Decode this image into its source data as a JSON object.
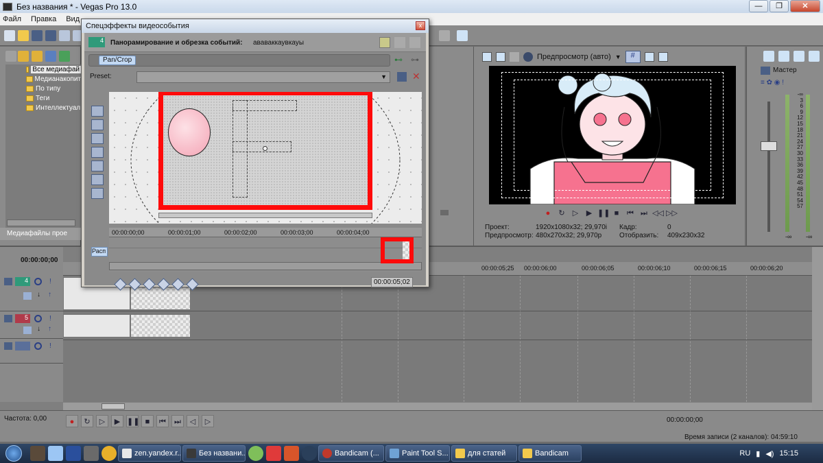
{
  "window": {
    "title": "Без названия * - Vegas Pro 13.0",
    "buttons": [
      "—",
      "❐",
      "✕"
    ]
  },
  "menubar": [
    "Файл",
    "Правка",
    "Вид"
  ],
  "explorer": {
    "tree": [
      {
        "label": "Все медиафай",
        "selected": true
      },
      {
        "label": "Медианакопит",
        "selected": false
      },
      {
        "label": "По типу",
        "selected": false
      },
      {
        "label": "Теги",
        "selected": false
      },
      {
        "label": "Интеллектуал",
        "selected": false
      }
    ],
    "tab_label": "Медиафайлы прое"
  },
  "dialog": {
    "title": "Спецэффекты видеособытия",
    "close": "x",
    "track_badge": "4",
    "fx_label": "Панорамирование и обрезка событий:",
    "fx_name": "ававаккаувкауы",
    "chain_button": "Pan/Crop",
    "preset_label": "Preset:",
    "keyframe_ruler": [
      "00:00:00;00",
      "00:00:01;00",
      "00:00:02;00",
      "00:00:03;00",
      "00:00:04;00"
    ],
    "position_label": "Расп",
    "time_readout": "00:00:05;02"
  },
  "preview": {
    "mode_label": "Предпросмотр (авто)",
    "info": [
      {
        "label": "Проект:",
        "value": "1920x1080x32; 29,970i",
        "label2": "Кадр:",
        "value2": "0"
      },
      {
        "label": "Предпросмотр:",
        "value": "480x270x32; 29,970p",
        "label2": "Отобразить:",
        "value2": "409x230x32"
      }
    ]
  },
  "mixer": {
    "title": "Мастер",
    "scale": [
      "-∞",
      "3",
      "6",
      "9",
      "12",
      "15",
      "18",
      "21",
      "24",
      "27",
      "30",
      "33",
      "36",
      "39",
      "42",
      "45",
      "48",
      "51",
      "54",
      "57"
    ],
    "bottom_left": "-∞",
    "bottom_right": "-∞"
  },
  "timeline": {
    "timecode": "00:00:00;00",
    "ruler": [
      "00:00:05;25",
      "00:00:06;00",
      "00:00:06;05",
      "00:00:06;10",
      "00:00:06;15",
      "00:00:06;20"
    ],
    "tracks": [
      {
        "num": "4",
        "color": "#2f9a7a"
      },
      {
        "num": "5",
        "color": "#b03a4a"
      },
      {
        "num": "",
        "color": "#5a6f9a"
      }
    ]
  },
  "bottom": {
    "rate": "Частота: 0,00",
    "timecode": "00:00:00;00",
    "record_time": "Время записи (2 каналов): 04:59:10"
  },
  "taskbar": {
    "tasks": [
      {
        "label": "zen.yandex.r...",
        "color": "#e8e8e8"
      },
      {
        "label": "Без названи...",
        "color": "#3a3a3a"
      },
      {
        "label": "Bandicam (...",
        "color": "#c0392b"
      },
      {
        "label": "Paint Tool S...",
        "color": "#6fa2d4"
      },
      {
        "label": "для статей",
        "color": "#f2c94c"
      },
      {
        "label": "Bandicam",
        "color": "#f2c94c"
      }
    ],
    "lang": "RU",
    "clock": "15:15"
  }
}
